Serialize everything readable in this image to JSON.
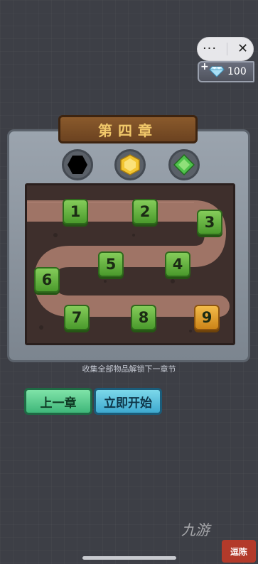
{
  "capsule": {
    "more_label": "···",
    "close_label": "✕"
  },
  "currency": {
    "plus": "+",
    "gem_icon": "diamond-icon",
    "count": "100"
  },
  "chapter": {
    "title": "第四章"
  },
  "collectibles": [
    {
      "name": "black-hexagon",
      "color": "#000000",
      "collected": false
    },
    {
      "name": "yellow-gem",
      "color": "#f2c531",
      "collected": true
    },
    {
      "name": "green-gem",
      "color": "#4fc24c",
      "collected": true
    }
  ],
  "levels": [
    {
      "label": "1",
      "state": "unlocked"
    },
    {
      "label": "2",
      "state": "unlocked"
    },
    {
      "label": "3",
      "state": "unlocked"
    },
    {
      "label": "4",
      "state": "unlocked"
    },
    {
      "label": "5",
      "state": "unlocked"
    },
    {
      "label": "6",
      "state": "unlocked"
    },
    {
      "label": "7",
      "state": "unlocked"
    },
    {
      "label": "8",
      "state": "unlocked"
    },
    {
      "label": "9",
      "state": "current"
    }
  ],
  "hint": "收集全部物品解锁下一章节",
  "buttons": {
    "prev": "上一章",
    "start": "立即开始"
  },
  "watermark": "九游",
  "corner_logo": "逗陈"
}
